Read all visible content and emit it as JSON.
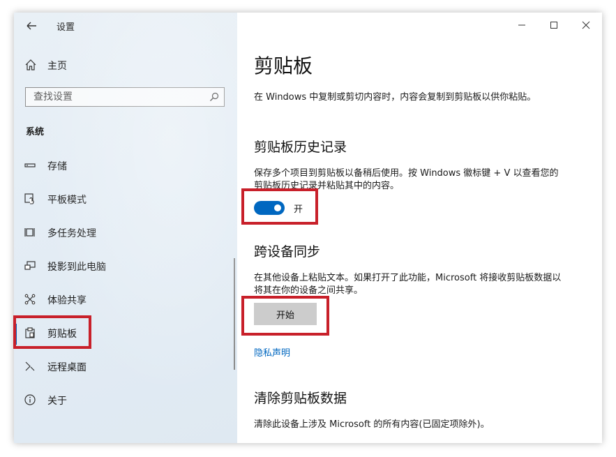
{
  "window": {
    "app_title": "设置",
    "controls": [
      "minimize-icon",
      "maximize-icon",
      "close-icon"
    ]
  },
  "sidebar": {
    "home_label": "主页",
    "search": {
      "placeholder": "查找设置"
    },
    "section_title": "系统",
    "items": [
      {
        "label": "存储",
        "icon": "storage-icon"
      },
      {
        "label": "平板模式",
        "icon": "tablet-mode-icon"
      },
      {
        "label": "多任务处理",
        "icon": "multitasking-icon"
      },
      {
        "label": "投影到此电脑",
        "icon": "projecting-icon"
      },
      {
        "label": "体验共享",
        "icon": "shared-experiences-icon"
      },
      {
        "label": "剪贴板",
        "icon": "clipboard-icon",
        "selected": true
      },
      {
        "label": "远程桌面",
        "icon": "remote-desktop-icon"
      },
      {
        "label": "关于",
        "icon": "info-icon"
      }
    ]
  },
  "main": {
    "title": "剪贴板",
    "intro": "在 Windows 中复制或剪切内容时，内容会复制到剪贴板以供你粘贴。",
    "history": {
      "heading": "剪贴板历史记录",
      "description": "保存多个项目到剪贴板以备稍后使用。按 Windows 徽标键 + V 以查看您的剪贴板历史记录并粘贴其中的内容。",
      "toggle_label": "开",
      "toggle_on": true
    },
    "sync": {
      "heading": "跨设备同步",
      "description": "在其他设备上粘贴文本。如果打开了此功能，Microsoft 将接收剪贴板数据以将其在你的设备之间共享。",
      "button_label": "开始"
    },
    "privacy_link": "隐私声明",
    "clear": {
      "heading": "清除剪贴板数据",
      "description": "清除此设备上涉及 Microsoft 的所有内容(已固定项除外)。"
    }
  },
  "colors": {
    "accent": "#0067c0",
    "highlight_box": "#c8202a",
    "button_gray": "#cccccc"
  }
}
